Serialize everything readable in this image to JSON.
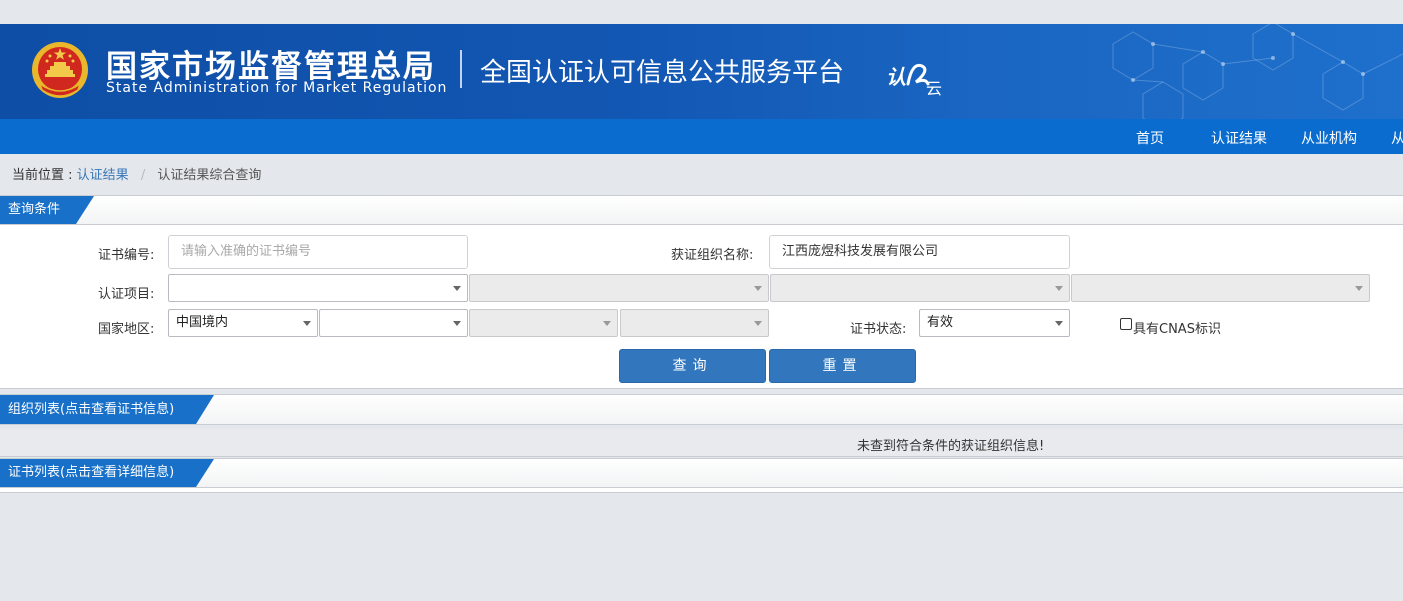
{
  "header": {
    "agency_cn": "国家市场监督管理总局",
    "agency_en": "State Administration  for  Market Regulation",
    "platform_title": "全国认证认可信息公共服务平台",
    "cloud_logo_text": "认云"
  },
  "nav": {
    "items": [
      {
        "label": "首页"
      },
      {
        "label": "认证结果"
      },
      {
        "label": "从业机构"
      },
      {
        "label": "从"
      }
    ]
  },
  "breadcrumb": {
    "label": "当前位置 :",
    "link": "认证结果",
    "separator": "/",
    "current": "认证结果综合查询"
  },
  "query_panel": {
    "title": "查询条件",
    "cert_no_label": "证书编号:",
    "cert_no_placeholder": "请输入准确的证书编号",
    "org_name_label": "获证组织名称:",
    "org_name_value": "江西庞煜科技发展有限公司",
    "cert_item_label": "认证项目:",
    "region_label": "国家地区:",
    "region_value": "中国境内",
    "status_label": "证书状态:",
    "status_value": "有效",
    "cnas_label": "具有CNAS标识",
    "cnas_checked": false,
    "search_button": "查询",
    "reset_button": "重置"
  },
  "org_list": {
    "title": "组织列表(点击查看证书信息)",
    "empty_message": "未查到符合条件的获证组织信息!"
  },
  "cert_list": {
    "title": "证书列表(点击查看详细信息)"
  },
  "colors": {
    "banner": "#1257b3",
    "navbar": "#0a6ccf",
    "tab": "#1870c9",
    "button": "#3277bd",
    "page_bg": "#e4e7eb"
  }
}
